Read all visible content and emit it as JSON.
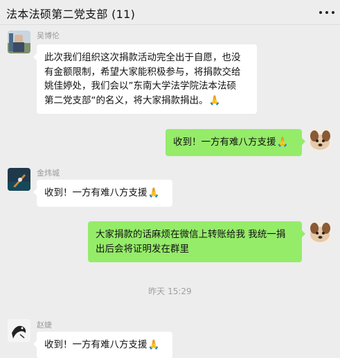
{
  "header": {
    "title": "法本法硕第二党支部 (11)",
    "more_icon": "more-horizontal-icon"
  },
  "messages": [
    {
      "side": "left",
      "sender": "吴博伦",
      "text": "此次我们组织这次捐款活动完全出于自愿，也没\n有金额限制，希望大家能积极参与，将捐款交给\n姚佳婷处，我们会以”东南大学法学院法本法硕\n第二党支部“的名义，将大家捐款捐出。",
      "emoji": "🙏"
    },
    {
      "side": "right",
      "text": "收到！一方有难八方支援",
      "emoji": "🙏"
    },
    {
      "side": "left",
      "sender": "金炜城",
      "text": "收到！一方有难八方支援",
      "emoji": "🙏"
    },
    {
      "side": "right",
      "text": "大家捐款的话麻烦在微信上转账给我 我统一捐\n出后会将证明发在群里",
      "emoji": ""
    },
    {
      "side": "left",
      "sender": "赵婕",
      "text": "收到！一方有难八方支援",
      "emoji": "🙏"
    }
  ],
  "timestamp": "昨天 15:29",
  "colors": {
    "background": "#ededed",
    "bubble_self": "#95ec69",
    "bubble_other": "#ffffff"
  }
}
